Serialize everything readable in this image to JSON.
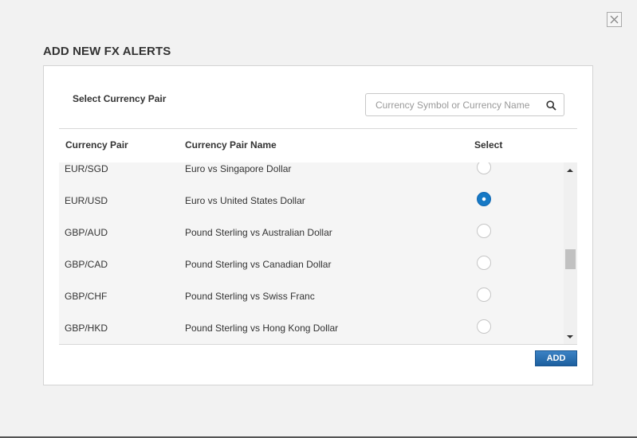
{
  "dialog": {
    "title": "ADD NEW FX ALERTS",
    "close_label": "×"
  },
  "panel": {
    "select_label": "Select Currency Pair",
    "search": {
      "placeholder": "Currency Symbol or Currency Name",
      "value": ""
    },
    "columns": [
      "Currency Pair",
      "Currency Pair Name",
      "Select"
    ],
    "rows": [
      {
        "pair": "EUR/SGD",
        "name": "Euro vs Singapore Dollar",
        "selected": false
      },
      {
        "pair": "EUR/USD",
        "name": "Euro vs United States Dollar",
        "selected": true
      },
      {
        "pair": "GBP/AUD",
        "name": "Pound Sterling vs Australian Dollar",
        "selected": false
      },
      {
        "pair": "GBP/CAD",
        "name": "Pound Sterling vs Canadian Dollar",
        "selected": false
      },
      {
        "pair": "GBP/CHF",
        "name": "Pound Sterling vs Swiss Franc",
        "selected": false
      },
      {
        "pair": "GBP/HKD",
        "name": "Pound Sterling vs Hong Kong Dollar",
        "selected": false
      }
    ],
    "add_label": "ADD"
  },
  "colors": {
    "accent": "#1679c5",
    "button": "#2a6fb3"
  },
  "icons": {
    "close": "close-icon",
    "search": "search-icon"
  }
}
